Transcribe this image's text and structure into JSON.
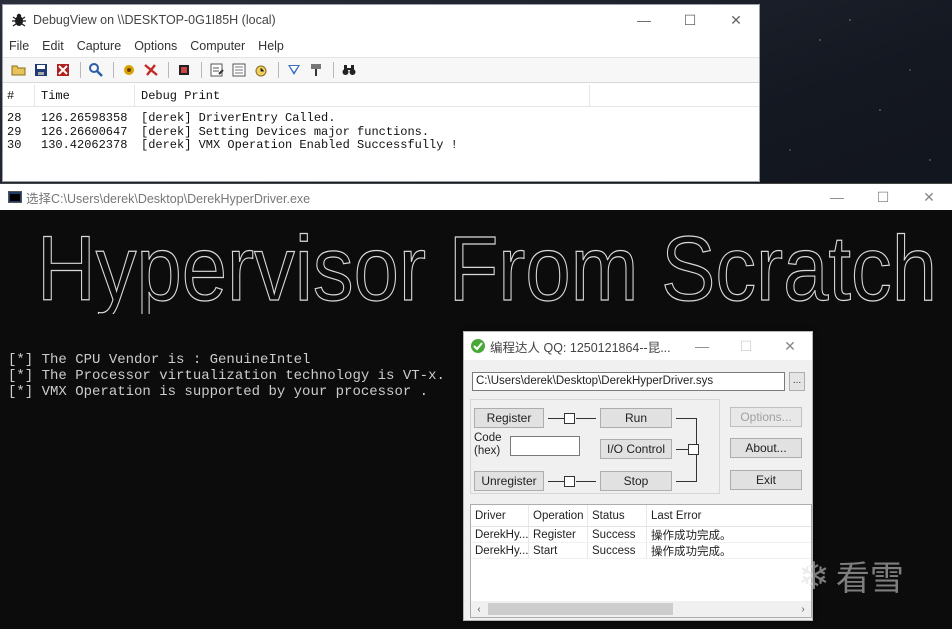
{
  "debugview": {
    "title": "DebugView on \\\\DESKTOP-0G1I85H (local)",
    "window_controls": {
      "minimize": "—",
      "maximize": "☐",
      "close": "✕"
    },
    "menu": [
      "File",
      "Edit",
      "Capture",
      "Options",
      "Computer",
      "Help"
    ],
    "toolbar_icons": [
      "open-icon",
      "save-icon",
      "clear-icon",
      "find-icon",
      "capture-icon",
      "filter-icon",
      "highlight-icon",
      "options-icon",
      "history-icon",
      "clock-icon",
      "autoscroll-icon",
      "pin-icon",
      "binoculars-icon"
    ],
    "columns": [
      "#",
      "Time",
      "Debug Print"
    ],
    "rows": [
      {
        "num": "28",
        "time": "126.26598358",
        "msg": "[derek] DriverEntry Called."
      },
      {
        "num": "29",
        "time": "126.26600647",
        "msg": "[derek] Setting Devices major functions."
      },
      {
        "num": "30",
        "time": "130.42062378",
        "msg": "[derek] VMX Operation Enabled Successfully !"
      }
    ]
  },
  "console": {
    "title": "选择C:\\Users\\derek\\Desktop\\DerekHyperDriver.exe",
    "window_controls": {
      "minimize": "—",
      "maximize": "☐",
      "close": "✕"
    },
    "banner": "Hypervisor From Scratch",
    "lines": [
      "[*] The CPU Vendor is : GenuineIntel",
      "[*] The Processor virtualization technology is VT-x.",
      "[*] VMX Operation is supported by your processor ."
    ]
  },
  "loader": {
    "title": "编程达人 QQ: 1250121864--昆...",
    "window_controls": {
      "minimize": "—",
      "maximize": "☐",
      "close": "✕"
    },
    "path": "C:\\Users\\derek\\Desktop\\DerekHyperDriver.sys",
    "browse_label": "...",
    "buttons": {
      "register": "Register",
      "run": "Run",
      "io_control": "I/O Control",
      "unregister": "Unregister",
      "stop": "Stop",
      "options": "Options...",
      "about": "About...",
      "exit": "Exit"
    },
    "code_label": "Code\n(hex)",
    "code_value": "",
    "list_columns": [
      "Driver",
      "Operation",
      "Status",
      "Last Error"
    ],
    "list_rows": [
      {
        "driver": "DerekHy...",
        "operation": "Register",
        "status": "Success",
        "error": "操作成功完成。"
      },
      {
        "driver": "DerekHy...",
        "operation": "Start",
        "status": "Success",
        "error": "操作成功完成。"
      }
    ],
    "scroll_left": "‹",
    "scroll_right": "›"
  },
  "watermark": {
    "text": "看雪",
    "icon": "snowflake-icon"
  },
  "colors": {
    "console_bg": "#0c0c0c",
    "console_text": "#cccccc",
    "dialog_bg": "#f0f0f0",
    "button_bg": "#e1e1e1"
  }
}
